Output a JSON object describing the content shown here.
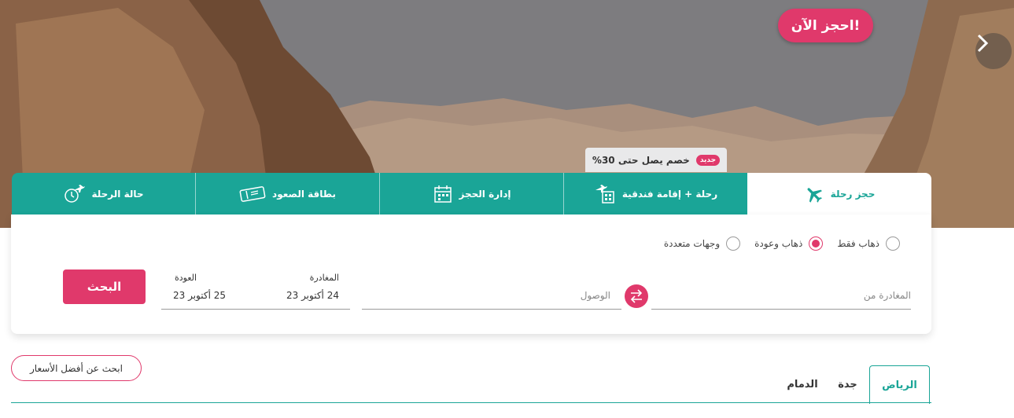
{
  "hero": {
    "book_now": "احجز الآن!",
    "promo_badge": "جديد",
    "promo_text": "خصم يصل حتى 30%"
  },
  "tabs": [
    {
      "label": "حجز رحلة",
      "icon": "plane-icon",
      "active": true
    },
    {
      "label": "رحلة + إقامة فندقية",
      "icon": "plane-hotel-icon",
      "active": false
    },
    {
      "label": "إدارة الحجز",
      "icon": "calendar-icon",
      "active": false
    },
    {
      "label": "بطاقة الصعود",
      "icon": "boarding-pass-icon",
      "active": false
    },
    {
      "label": "حالة الرحلة",
      "icon": "flight-status-icon",
      "active": false
    }
  ],
  "trip_type": {
    "options": [
      "ذهاب فقط",
      "ذهاب وعودة",
      "وجهات متعددة"
    ],
    "selected": "ذهاب وعودة"
  },
  "search": {
    "from_placeholder": "المغادرة من",
    "to_placeholder": "الوصول",
    "departure_label": "المغادرة",
    "departure_value": "24 أكتوبر 23",
    "return_label": "العودة",
    "return_value": "25 أكتوبر 23",
    "search_button": "البحث"
  },
  "best_price_button": "ابحث عن أفضل الأسعار",
  "cities": [
    {
      "label": "الرياض",
      "active": true
    },
    {
      "label": "جدة",
      "active": false
    },
    {
      "label": "الدمام",
      "active": false
    }
  ],
  "colors": {
    "brand_pink": "#e0396b",
    "brand_teal": "#1aa597"
  }
}
